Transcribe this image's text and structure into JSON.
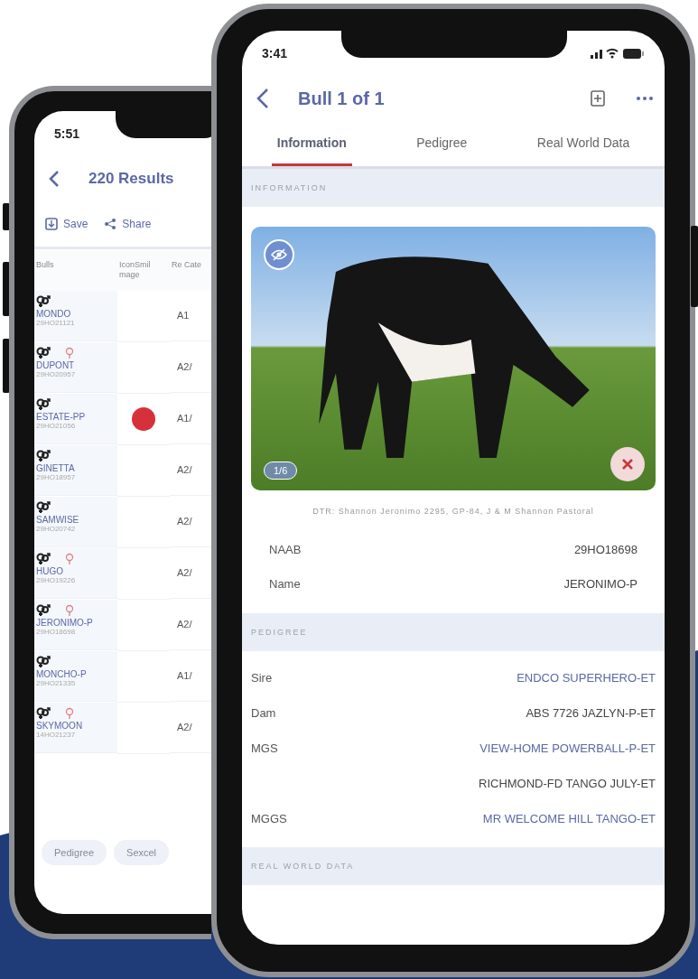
{
  "back_phone": {
    "status_time": "5:51",
    "title": "220 Results",
    "toolbar": [
      "Save",
      "Share"
    ],
    "columns": [
      "Bulls",
      "IconSmil mage",
      "Re Cate"
    ],
    "rows": [
      {
        "name": "MONDO",
        "id": "29HO21121",
        "category": "A1",
        "marker": false,
        "badge": false
      },
      {
        "name": "DUPONT",
        "id": "29HO20957",
        "category": "A2/",
        "marker": true,
        "badge": false
      },
      {
        "name": "ESTATE-PP",
        "id": "29HO21056",
        "category": "A1/",
        "marker": false,
        "badge": true
      },
      {
        "name": "GINETTA",
        "id": "29HO18957",
        "category": "A2/",
        "marker": false,
        "badge": false
      },
      {
        "name": "SAMWISE",
        "id": "29HO20742",
        "category": "A2/",
        "marker": false,
        "badge": false
      },
      {
        "name": "HUGO",
        "id": "29HO19226",
        "category": "A2/",
        "marker": true,
        "badge": false
      },
      {
        "name": "JERONIMO-P",
        "id": "29HO18698",
        "category": "A2/",
        "marker": true,
        "badge": false
      },
      {
        "name": "MONCHO-P",
        "id": "29HO21335",
        "category": "A1/",
        "marker": false,
        "badge": false
      },
      {
        "name": "SKYMOON",
        "id": "14HO21237",
        "category": "A2/",
        "marker": true,
        "badge": false
      }
    ],
    "buttons": [
      "Pedigree",
      "Sexcel"
    ]
  },
  "front_phone": {
    "status_time": "3:41",
    "title": "Bull 1 of 1",
    "tabs": [
      {
        "label": "Information",
        "selected": true
      },
      {
        "label": "Pedigree",
        "selected": false
      },
      {
        "label": "Real World Data",
        "selected": false
      }
    ],
    "information": {
      "header": "INFORMATION",
      "photo_counter": "1/6",
      "caption": "DTR: Shannon Jeronimo 2295, GP-84, J & M Shannon Pastoral",
      "fields": [
        {
          "label": "NAAB",
          "value": "29HO18698"
        },
        {
          "label": "Name",
          "value": "JERONIMO-P"
        }
      ]
    },
    "pedigree": {
      "header": "PEDIGREE",
      "rows": [
        {
          "label": "Sire",
          "value": "ENDCO SUPERHERO-ET",
          "link": true
        },
        {
          "label": "Dam",
          "value": "ABS 7726 JAZLYN-P-ET",
          "link": false
        },
        {
          "label": "MGS",
          "value": "VIEW-HOME POWERBALL-P-ET",
          "link": true
        },
        {
          "value": "RICHMOND-FD TANGO JULY-ET",
          "link": false
        },
        {
          "label": "MGGS",
          "value": "MR WELCOME HILL TANGO-ET",
          "link": true
        }
      ]
    },
    "real_world_header": "REAL WORLD DATA"
  }
}
